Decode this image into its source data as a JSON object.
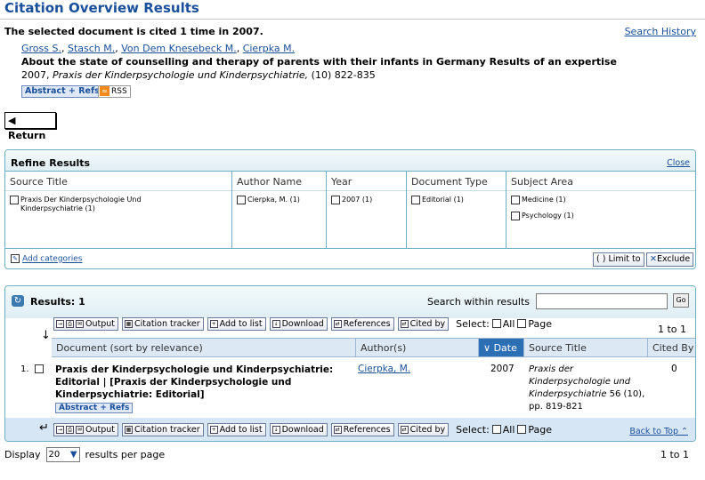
{
  "header": {
    "title": "Citation Overview Results",
    "cited_summary": "The selected document is cited 1 time in 2007.",
    "search_history": "Search History"
  },
  "document": {
    "authors": [
      "Gross S.",
      "Stasch M.",
      "Von Dem Knesebeck M.",
      "Cierpka M."
    ],
    "title": "About the state of counselling and therapy of parents with their infants in Germany    Results of an expertise",
    "source_year": "2007,",
    "source_journal": "Praxis der Kinderpsychologie und Kinderpsychiatrie,",
    "source_rest": "(10) 822-835",
    "abstract_refs": "Abstract + Refs",
    "rss": "RSS"
  },
  "return_label": "Return",
  "refine": {
    "title": "Refine Results",
    "close": "Close",
    "columns": [
      {
        "header": "Source Title",
        "options": [
          "Praxis Der Kinderpsychologie Und Kinderpsychiatrie (1)"
        ]
      },
      {
        "header": "Author Name",
        "options": [
          "Cierpka, M. (1)"
        ]
      },
      {
        "header": "Year",
        "options": [
          "2007 (1)"
        ]
      },
      {
        "header": "Document Type",
        "options": [
          "Editorial (1)"
        ]
      },
      {
        "header": "Subject Area",
        "options": [
          "Medicine (1)",
          "Psychology (1)"
        ]
      }
    ],
    "add_categories": "Add categories",
    "limit_to": "Limit to",
    "exclude": "Exclude"
  },
  "results": {
    "label": "Results: 1",
    "search_within": "Search within results",
    "search_value": "",
    "go": "Go",
    "count": "1 to 1",
    "toolbar": {
      "output": "Output",
      "citation_tracker": "Citation tracker",
      "add_to_list": "Add to list",
      "download": "Download",
      "references": "References",
      "cited_by": "Cited by",
      "select": "Select:",
      "all": "All",
      "page": "Page"
    },
    "columns": {
      "document": "Document (sort by relevance)",
      "authors": "Author(s)",
      "date": "Date",
      "source": "Source Title",
      "cited_by": "Cited By"
    },
    "rows": [
      {
        "num": "1.",
        "title": "Praxis der Kinderpsychologie und Kinderpsychiatrie: Editorial | [Praxis der Kinderpsychologie und Kinderpsychiatrie: Editorial]",
        "abstract_refs": "Abstract + Refs",
        "author": "Cierpka, M.",
        "date": "2007",
        "source_italic": "Praxis der Kinderpsychologie und Kinderpsychiatrie",
        "source_rest": " 56 (10), pp. 819-821",
        "cited_by": "0"
      }
    ],
    "back_to_top": "Back to Top"
  },
  "display": {
    "label_before": "Display",
    "value": "20",
    "label_after": "results per page",
    "count": "1 to 1"
  }
}
